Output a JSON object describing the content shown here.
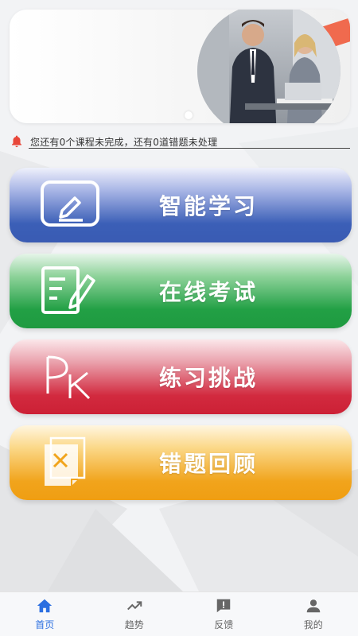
{
  "notice": {
    "text": "您还有0个课程未完成，还有0道错题未处理",
    "icon": "bell-icon",
    "icon_color": "#e8473a"
  },
  "menu": [
    {
      "label": "智能学习",
      "icon": "write-icon",
      "color": "#3b5fb7"
    },
    {
      "label": "在线考试",
      "icon": "exam-icon",
      "color": "#22a045"
    },
    {
      "label": "练习挑战",
      "icon": "pk-icon",
      "color": "#d22a3f"
    },
    {
      "label": "错题回顾",
      "icon": "wrong-doc-icon",
      "color": "#f1a41c"
    }
  ],
  "tabs": [
    {
      "label": "首页",
      "icon": "home-icon",
      "active": true
    },
    {
      "label": "趋势",
      "icon": "trend-icon",
      "active": false
    },
    {
      "label": "反馈",
      "icon": "feedback-icon",
      "active": false
    },
    {
      "label": "我的",
      "icon": "user-icon",
      "active": false
    }
  ],
  "colors": {
    "active_tab": "#2b6fe0",
    "inactive_tab": "#666666"
  }
}
